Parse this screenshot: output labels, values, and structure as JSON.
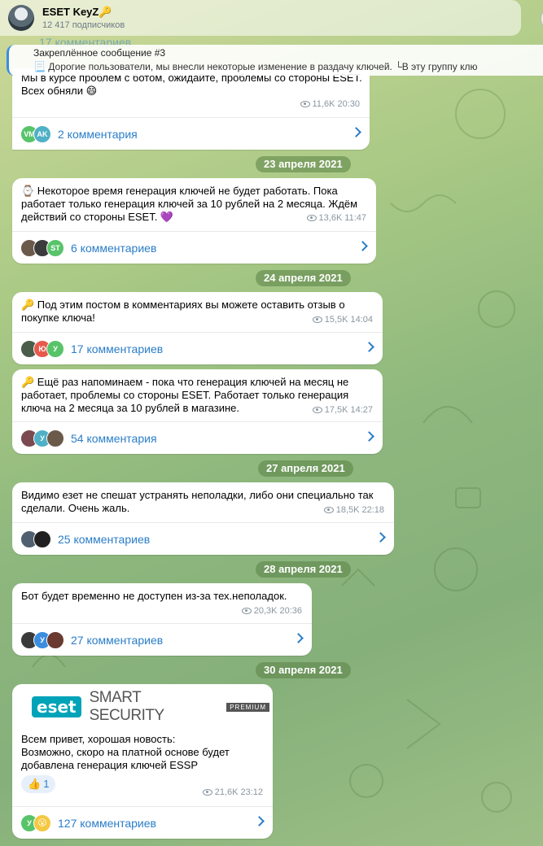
{
  "channel": {
    "title": "ESET KeyZ🔑",
    "subscribers": "12 417 подписчиков"
  },
  "pinned": {
    "title": "Закреплённое сообщение #3",
    "text": "📃 Дорогие пользователи, мы внесли некоторые изменение в раздачу ключей. └В эту группу клю"
  },
  "ghost_comments": "17 комментариев",
  "messages": [
    {
      "text": "Мы в курсе проблем с ботом, ожидайте, проблемы со стороны ESET.\nВсех обняли 😄",
      "views": "11,6K",
      "time": "20:30",
      "comments": "2 комментария",
      "avatars": [
        {
          "initials": "VM",
          "color": "#58c46a"
        },
        {
          "initials": "AK",
          "color": "#4fb0c6"
        }
      ]
    },
    {
      "date": "23 апреля 2021",
      "text": "⌚ Некоторое время генерация ключей не будет работать. Пока работает только генерация ключей за 10 рублей на 2 месяца. Ждём действий со стороны ESET. 💜",
      "views": "13,6K",
      "time": "11:47",
      "comments": "6 комментариев",
      "avatars": [
        {
          "initials": "",
          "color": "#6b5a4a"
        },
        {
          "initials": "",
          "color": "#3b3b3b"
        },
        {
          "initials": "ST",
          "color": "#58c46a"
        }
      ]
    },
    {
      "date": "24 апреля 2021",
      "text": "🔑 Под этим постом в комментариях вы можете оставить отзыв о покупке ключа!",
      "views": "15,5K",
      "time": "14:04",
      "comments": "17 комментариев",
      "avatars": [
        {
          "initials": "",
          "color": "#4a5d48"
        },
        {
          "initials": "Ю",
          "color": "#e8584c"
        },
        {
          "initials": "У",
          "color": "#58c46a"
        }
      ]
    },
    {
      "text": "🔑 Ещё раз напоминаем - пока что генерация ключей на месяц не работает, проблемы со стороны ESET. Работает только генерация ключа на 2 месяца за 10 рублей в магазине.",
      "views": "17,5K",
      "time": "14:27",
      "comments": "54 комментария",
      "avatars": [
        {
          "initials": "",
          "color": "#7a4a50"
        },
        {
          "initials": "У",
          "color": "#4fb0c6"
        },
        {
          "initials": "",
          "color": "#6b5a4a"
        }
      ]
    },
    {
      "date": "27 апреля 2021",
      "text": "Видимо езет не спешат устранять неполадки, либо они специально так сделали. Очень жаль.",
      "views": "18,5K",
      "time": "22:18",
      "comments": "25 комментариев",
      "avatars": [
        {
          "initials": "",
          "color": "#506070"
        },
        {
          "initials": "",
          "color": "#202020"
        }
      ]
    },
    {
      "date": "28 апреля 2021",
      "text": "Бот будет временно не доступен из-за тех.неполадок.",
      "views": "20,3K",
      "time": "20:36",
      "comments": "27 комментариев",
      "avatars": [
        {
          "initials": "",
          "color": "#3a3a3a"
        },
        {
          "initials": "У",
          "color": "#3b8de0"
        },
        {
          "initials": "",
          "color": "#6a3a30"
        }
      ]
    },
    {
      "date": "30 апреля 2021",
      "banner": {
        "logo": "eset",
        "product": "SMART SECURITY",
        "edition": "PREMIUM"
      },
      "text": "Всем привет, хорошая новость:\nВозможно, скоро на платной основе будет добавлена генерация ключей ESSP",
      "reaction": {
        "emoji": "👍",
        "count": "1"
      },
      "views": "21,6K",
      "time": "23:12",
      "comments": "127 комментариев",
      "avatars": [
        {
          "initials": "У",
          "color": "#58c46a"
        },
        {
          "initials": "😮",
          "color": "#f5c842"
        }
      ]
    }
  ]
}
